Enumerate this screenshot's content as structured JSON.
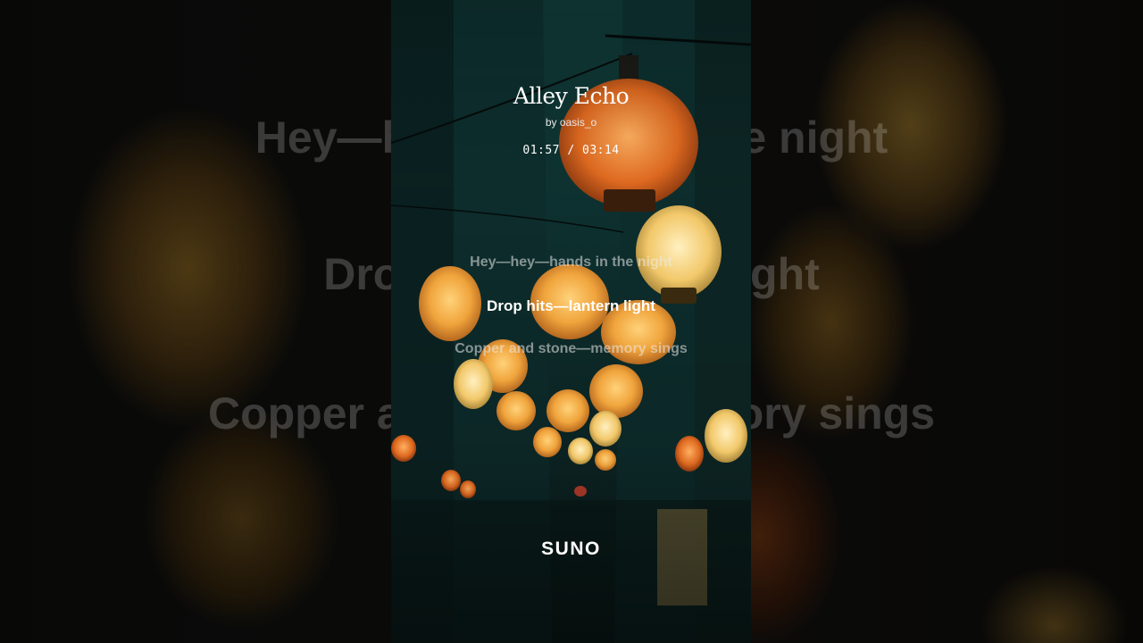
{
  "song": {
    "title": "Alley Echo",
    "artist": "by oasis_o",
    "time": "01:57 / 03:14"
  },
  "lyrics": {
    "previous": "Hey—hey—hands in the night",
    "current": "Drop hits—lantern light",
    "next": "Copper and stone—memory sings"
  },
  "background_lyrics": {
    "line1": "Hey—hey—hands in the night",
    "line2": "Drop hits—lantern light",
    "line3": "Copper and stone—memory sings"
  },
  "brand": {
    "logo": "SUNO"
  },
  "colors": {
    "panel_teal": "#0f3a38",
    "lantern_orange": "#e0782a",
    "lantern_glow": "#ffb24a"
  }
}
